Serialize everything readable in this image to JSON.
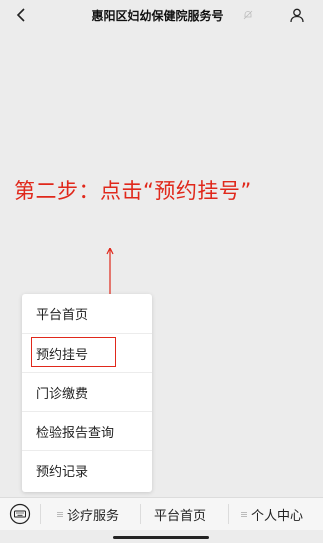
{
  "header": {
    "title": "惠阳区妇幼保健院服务号",
    "back_icon": "chevron-left-icon",
    "mute_icon": "bell-mute-icon",
    "profile_icon": "person-icon"
  },
  "instruction": {
    "text": "第二步：点击“预约挂号”",
    "color": "#e0281b"
  },
  "menu": {
    "items": [
      {
        "label": "平台首页"
      },
      {
        "label": "预约挂号",
        "highlighted": true
      },
      {
        "label": "门诊缴费"
      },
      {
        "label": "检验报告查询"
      },
      {
        "label": "预约记录"
      }
    ],
    "highlight_color": "#e0281b"
  },
  "bottom_bar": {
    "keyboard_icon": "keyboard-icon",
    "items": [
      {
        "label": "诊疗服务",
        "has_menu_glyph": true
      },
      {
        "label": "平台首页",
        "has_menu_glyph": false
      },
      {
        "label": "个人中心",
        "has_menu_glyph": true
      }
    ]
  }
}
